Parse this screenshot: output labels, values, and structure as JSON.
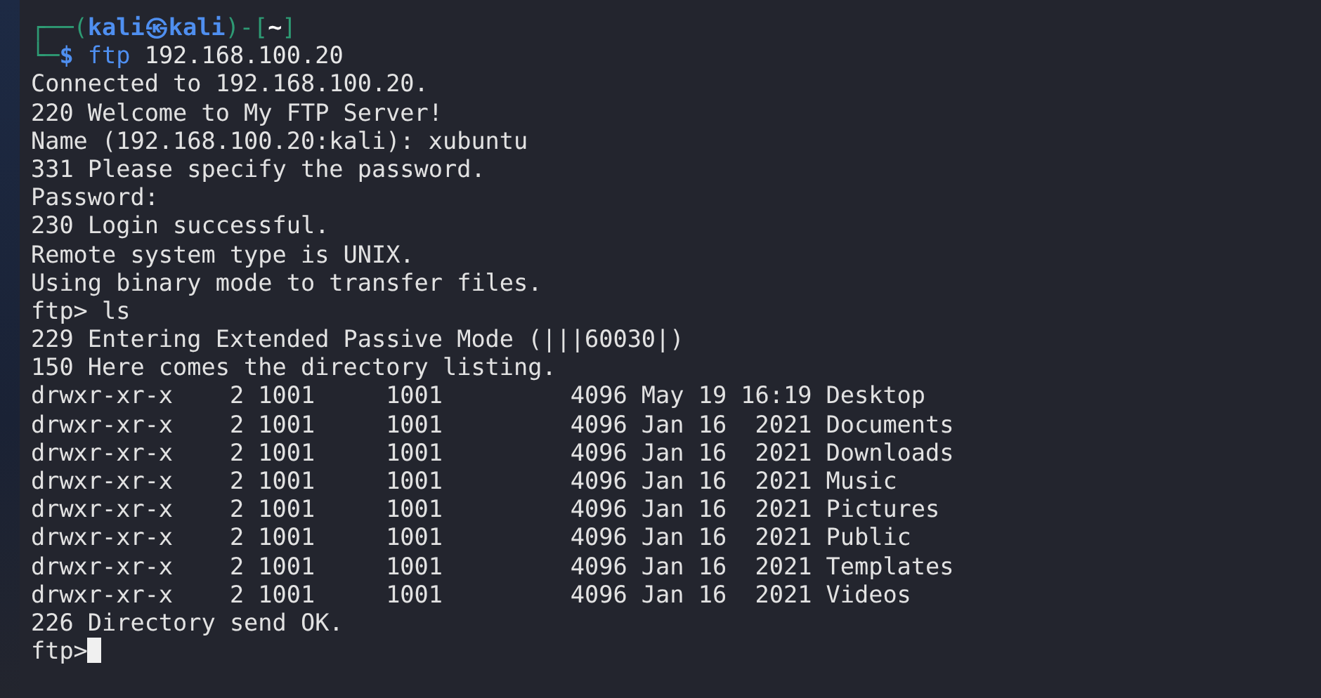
{
  "prompt_lines": [
    {
      "segments": [
        {
          "text": "┌──(",
          "kind": "frame"
        },
        {
          "text": "kali㉿kali",
          "kind": "user"
        },
        {
          "text": ")-[",
          "kind": "frame"
        },
        {
          "text": "~",
          "kind": "dir"
        },
        {
          "text": "]",
          "kind": "frame"
        }
      ]
    },
    {
      "segments": [
        {
          "text": "└─",
          "kind": "frame"
        },
        {
          "text": "$",
          "kind": "user"
        },
        {
          "text": " ftp",
          "kind": "command"
        },
        {
          "text": " 192.168.100.20",
          "kind": "arg"
        }
      ]
    }
  ],
  "output": [
    "Connected to 192.168.100.20.",
    "220 Welcome to My FTP Server!",
    "Name (192.168.100.20:kali): xubuntu",
    "331 Please specify the password.",
    "Password:",
    "230 Login successful.",
    "Remote system type is UNIX.",
    "Using binary mode to transfer files.",
    "ftp> ls",
    "229 Entering Extended Passive Mode (|||60030|)",
    "150 Here comes the directory listing.",
    "drwxr-xr-x    2 1001     1001         4096 May 19 16:19 Desktop",
    "drwxr-xr-x    2 1001     1001         4096 Jan 16  2021 Documents",
    "drwxr-xr-x    2 1001     1001         4096 Jan 16  2021 Downloads",
    "drwxr-xr-x    2 1001     1001         4096 Jan 16  2021 Music",
    "drwxr-xr-x    2 1001     1001         4096 Jan 16  2021 Pictures",
    "drwxr-xr-x    2 1001     1001         4096 Jan 16  2021 Public",
    "drwxr-xr-x    2 1001     1001         4096 Jan 16  2021 Templates",
    "drwxr-xr-x    2 1001     1001         4096 Jan 16  2021 Videos",
    "226 Directory send OK."
  ],
  "input_prompt": "ftp>"
}
